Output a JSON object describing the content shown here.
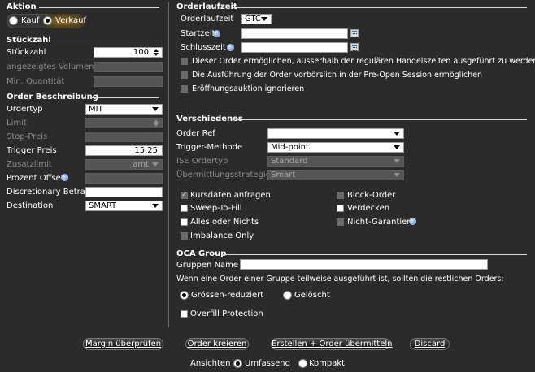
{
  "aktion": {
    "title": "Aktion",
    "kauf": "Kauf",
    "verkauf": "Verkauf"
  },
  "stueckzahl": {
    "title": "Stückzahl",
    "label": "Stückzahl",
    "value": "100",
    "angezeigtes_volumen": "angezeigtes Volumen",
    "min_quantitaet": "Min. Quantität"
  },
  "order_beschreibung": {
    "title": "Order Beschreibung",
    "ordertyp_label": "Ordertyp",
    "ordertyp_value": "MIT",
    "limit": "Limit",
    "stop_preis": "Stop-Preis",
    "trigger_preis_label": "Trigger Preis",
    "trigger_preis_value": "15.25",
    "zusatzlimit_label": "Zusatzlimit",
    "zusatzlimit_value": "amt",
    "prozent_offset": "Prozent Offset",
    "discretionary_betrag": "Discretionary Betrag",
    "destination_label": "Destination",
    "destination_value": "SMART"
  },
  "orderlaufzeit": {
    "title": "Orderlaufzeit",
    "label": "Orderlaufzeit",
    "value": "GTC",
    "startzeit": "Startzeit",
    "schlusszeit": "Schlusszeit",
    "options": [
      "Dieser Order ermöglichen, ausserhalb der regulären Handelszeiten ausgeführt zu werden",
      "Die Ausführung der Order vorbörslich in der Pre-Open Session ermöglichen",
      "Eröffnungsauktion ignorieren"
    ]
  },
  "verschiedenes": {
    "title": "Verschiedenes",
    "order_ref": "Order Ref",
    "trigger_methode_label": "Trigger-Methode",
    "trigger_methode_value": "Mid-point",
    "ise_ordertyp_label": "ISE Ordertyp",
    "ise_ordertyp_value": "Standard",
    "uebermittlung_label": "Übermittlungsstrategie",
    "uebermittlung_value": "Smart",
    "kursdaten": "Kursdaten anfragen",
    "sweep": "Sweep-To-Fill",
    "alles_oder_nichts": "Alles oder Nichts",
    "imbalance_only": "Imbalance Only",
    "block_order": "Block-Order",
    "verdecken": "Verdecken",
    "nicht_garantiert": "Nicht-Garantiert"
  },
  "oca": {
    "title": "OCA Group",
    "gruppen_name": "Gruppen Name",
    "description": "Wenn eine Order einer Gruppe teilweise ausgeführt ist, sollten die restlichen Orders:",
    "groessen_reduziert": "Grössen-reduziert",
    "geloescht": "Gelöscht",
    "overfill": "Overfill Protection"
  },
  "buttons": {
    "margin": "Margin überprüfen",
    "kreieren": "Order kreieren",
    "erstellen": "Erstellen + Order übermitteln",
    "discard": "Discard"
  },
  "ansichten": {
    "label": "Ansichten",
    "umfassend": "Umfassend",
    "kompakt": "Kompakt"
  }
}
